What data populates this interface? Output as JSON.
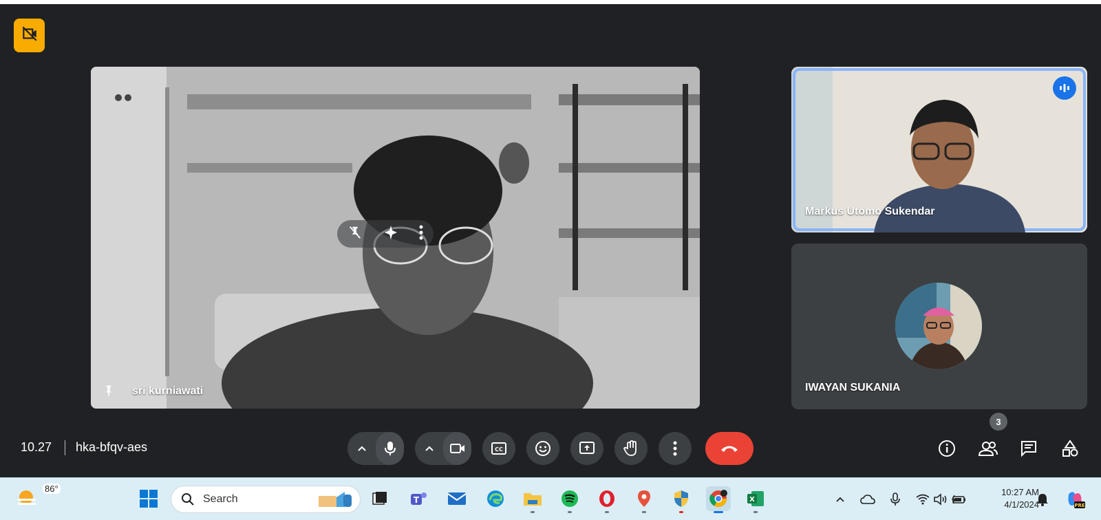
{
  "meeting": {
    "main_participant": "sri kurniawati",
    "participants": [
      {
        "name": "Markus Utomo Sukendar"
      },
      {
        "name": "IWAYAN SUKANIA"
      }
    ],
    "time": "10.27",
    "code": "hka-bfqv-aes",
    "people_count": "3"
  },
  "taskbar": {
    "weather_temp": "86°",
    "search_placeholder": "Search",
    "clock_time": "10:27 AM",
    "clock_date": "4/1/2024"
  },
  "colors": {
    "meet_bg": "#202124",
    "accent": "#1a73e8",
    "end_call": "#ea4335",
    "badge": "#f9ab00"
  }
}
